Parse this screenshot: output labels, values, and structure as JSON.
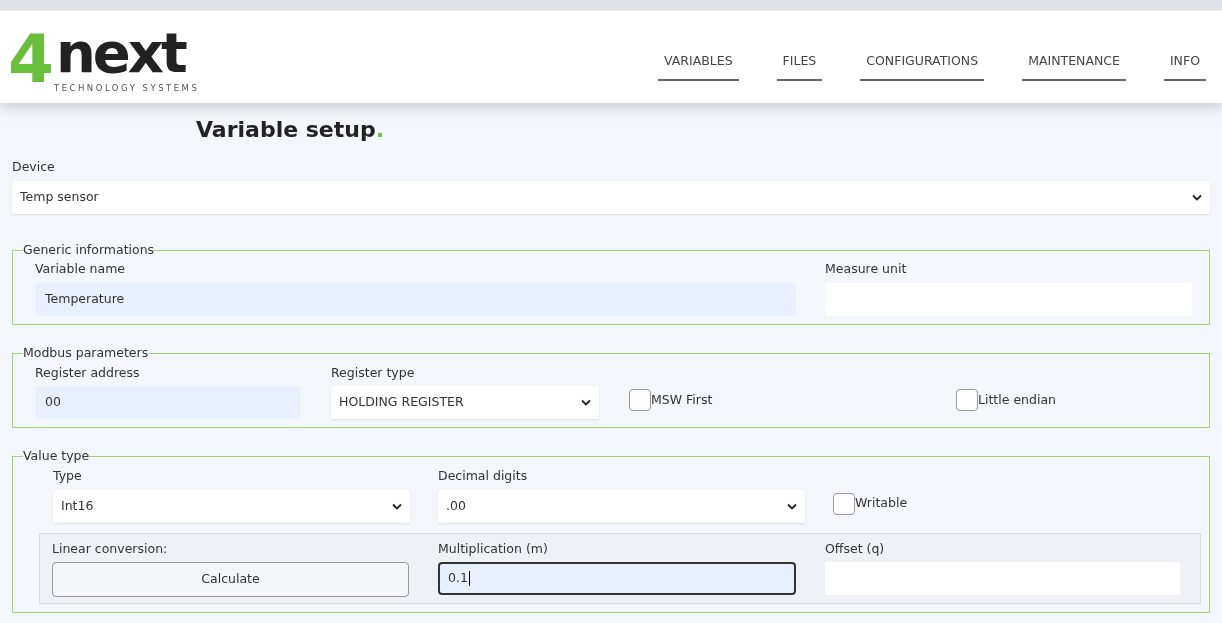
{
  "logo": {
    "numeral": "4",
    "word": "next",
    "tagline": "TECHNOLOGY SYSTEMS"
  },
  "nav": [
    {
      "label": "VARIABLES",
      "selected": false
    },
    {
      "label": "FILES",
      "selected": false
    },
    {
      "label": "CONFIGURATIONS",
      "selected": false
    },
    {
      "label": "MAINTENANCE",
      "selected": false
    },
    {
      "label": "INFO",
      "selected": false
    }
  ],
  "heading": {
    "text": "Variable setup",
    "accent": "."
  },
  "device": {
    "label": "Device",
    "value": "Temp sensor"
  },
  "sections": [
    {
      "legend": "Generic informations",
      "fields": [
        {
          "kind": "input",
          "label": "Variable name",
          "value": "Temperature",
          "autofilled": true,
          "focused": false
        },
        {
          "kind": "input",
          "label": "Measure unit",
          "autofilled": false,
          "focused": false
        }
      ]
    },
    {
      "legend": "Modbus parameters",
      "fields": [
        {
          "kind": "input",
          "label": "Register address",
          "value": "00",
          "autofilled": true,
          "focused": false
        },
        {
          "kind": "select",
          "label": "Register type",
          "value": "HOLDING REGISTER"
        },
        {
          "kind": "checkbox",
          "label": "MSW First",
          "checked": false
        },
        {
          "kind": "checkbox",
          "label": "Little endian",
          "checked": false
        }
      ]
    },
    {
      "legend": "Value type",
      "fields": [
        {
          "kind": "select",
          "label": "Type",
          "value": "Int16"
        },
        {
          "kind": "select",
          "label": "Decimal digits",
          "value": ".00"
        },
        {
          "kind": "checkbox",
          "label": "Writable",
          "checked": false
        }
      ],
      "panel": [
        {
          "kind": "button",
          "label": "Linear conversion:",
          "text": "Calculate"
        },
        {
          "kind": "input",
          "label": "Multiplication (m)",
          "value": "0.1",
          "autofilled": true,
          "focused": true
        },
        {
          "kind": "input",
          "label": "Offset (q)",
          "autofilled": false,
          "focused": false
        }
      ]
    }
  ]
}
